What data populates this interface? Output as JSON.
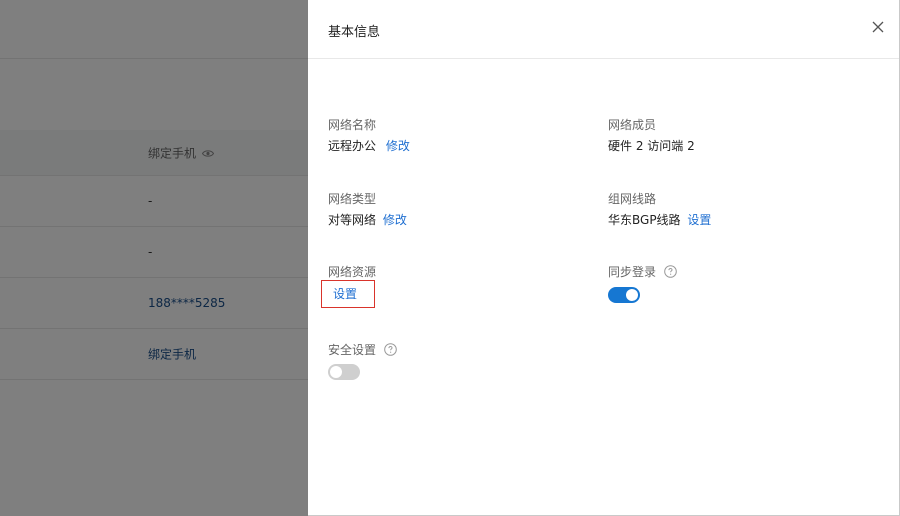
{
  "background": {
    "table_header": "绑定手机",
    "rows": [
      "-",
      "-",
      "188****5285",
      "绑定手机"
    ]
  },
  "drawer": {
    "title": "基本信息",
    "network_name": {
      "label": "网络名称",
      "value": "远程办公",
      "action": "修改"
    },
    "network_members": {
      "label": "网络成员",
      "value": "硬件 2 访问端 2"
    },
    "network_type": {
      "label": "网络类型",
      "value": "对等网络",
      "action": "修改"
    },
    "network_line": {
      "label": "组网线路",
      "value": "华东BGP线路",
      "action": "设置"
    },
    "network_resource": {
      "label": "网络资源",
      "action": "设置"
    },
    "sync_login": {
      "label": "同步登录",
      "enabled": true
    },
    "security": {
      "label": "安全设置",
      "enabled": false
    }
  },
  "colors": {
    "accent": "#1677d2",
    "link": "#1f6fd1",
    "highlight": "#d9342b"
  },
  "icons": {
    "close": "close-icon",
    "help": "help-circle-icon",
    "eye": "eye-icon"
  }
}
